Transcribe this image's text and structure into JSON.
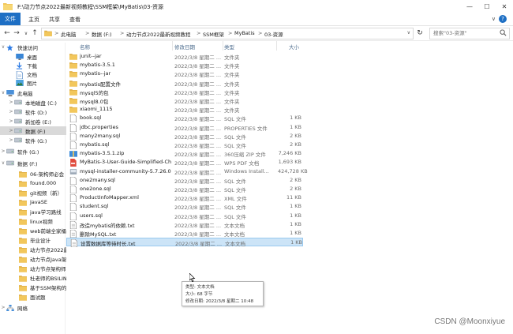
{
  "window": {
    "title": "F:\\动力节点2022最新视频教程\\SSM框架\\MyBatis\\03-资源"
  },
  "window_controls": {
    "minimize": "—",
    "maximize": "☐",
    "close": "✕"
  },
  "menu": {
    "file": "文件",
    "tabs": [
      "主页",
      "共享",
      "查看"
    ],
    "help": "?",
    "collapse": "∨"
  },
  "nav": {
    "back": "←",
    "forward": "→",
    "up_menu": "∨",
    "up": "↑",
    "refresh": "↻",
    "address_dropdown": "∨"
  },
  "address": {
    "crumbs": [
      "此电脑",
      "数据 (F:)",
      "动力节点2022最新视频教程",
      "SSM框架",
      "MyBatis",
      "03-资源"
    ],
    "separator": ">"
  },
  "search": {
    "placeholder": "搜索\"03-资源\""
  },
  "columns": {
    "name": "名称",
    "date": "修改日期",
    "type": "类型",
    "size": "大小"
  },
  "sidebar": [
    {
      "label": "快速访问",
      "icon": "star-icon",
      "chevron": "∨",
      "top": 0
    },
    {
      "label": "桌面",
      "icon": "desktop-icon",
      "pin": "📌"
    },
    {
      "label": "下载",
      "icon": "download-icon",
      "pin": "📌"
    },
    {
      "label": "文档",
      "icon": "document-icon",
      "pin": "📌"
    },
    {
      "label": "图片",
      "icon": "picture-icon",
      "pin": "📌"
    },
    {
      "label": "此电脑",
      "icon": "pc-icon",
      "chevron": "∨"
    },
    {
      "label": "本地磁盘 (C:)",
      "icon": "drive-icon",
      "chevron": ">"
    },
    {
      "label": "软件 (D:)",
      "icon": "drive-icon",
      "chevron": ">"
    },
    {
      "label": "新加卷 (E:)",
      "icon": "drive-icon",
      "chevron": ">"
    },
    {
      "label": "数据 (F:)",
      "icon": "drive-icon",
      "chevron": ">",
      "selected": true
    },
    {
      "label": "软件 (G:)",
      "icon": "drive-icon",
      "chevron": ">"
    },
    {
      "label": "软件 (G:)",
      "icon": "drive-icon",
      "chevron": ">"
    },
    {
      "label": "数据 (F:)",
      "icon": "drive-icon",
      "chevron": "∨"
    },
    {
      "label": "06-架构师必会",
      "icon": "folder-icon"
    },
    {
      "label": "found.000",
      "icon": "folder-icon"
    },
    {
      "label": "git视频（新）",
      "icon": "folder-icon"
    },
    {
      "label": "JavaSE",
      "icon": "folder-icon"
    },
    {
      "label": "java学习路线",
      "icon": "folder-icon"
    },
    {
      "label": "linux视频",
      "icon": "folder-icon"
    },
    {
      "label": "web前端全家桶(服",
      "icon": "folder-icon"
    },
    {
      "label": "毕业设计",
      "icon": "folder-icon"
    },
    {
      "label": "动力节点2022最新",
      "icon": "folder-icon"
    },
    {
      "label": "动力节点Java架构",
      "icon": "folder-icon"
    },
    {
      "label": "动力节点架构师学",
      "icon": "folder-icon"
    },
    {
      "label": "杜老师的BSILINUX",
      "icon": "folder-icon"
    },
    {
      "label": "基于SSM架构的商",
      "icon": "folder-icon"
    },
    {
      "label": "面试题",
      "icon": "folder-icon"
    },
    {
      "label": "网络",
      "icon": "network-icon",
      "chevron": ">"
    }
  ],
  "files": [
    {
      "name": "junit--jar",
      "date": "2022/3/8 星期二 ...",
      "type": "文件夹",
      "size": "",
      "icon": "folder-icon"
    },
    {
      "name": "mybatis-3.5.1",
      "date": "2022/3/8 星期二 ...",
      "type": "文件夹",
      "size": "",
      "icon": "folder-icon"
    },
    {
      "name": "mybatis--jar",
      "date": "2022/3/8 星期二 ...",
      "type": "文件夹",
      "size": "",
      "icon": "folder-icon"
    },
    {
      "name": "mybatis配置文件",
      "date": "2022/3/8 星期二 ...",
      "type": "文件夹",
      "size": "",
      "icon": "folder-icon"
    },
    {
      "name": "mysql5的包",
      "date": "2022/3/8 星期二 ...",
      "type": "文件夹",
      "size": "",
      "icon": "folder-icon"
    },
    {
      "name": "mysql8.0包",
      "date": "2022/3/8 星期二 ...",
      "type": "文件夹",
      "size": "",
      "icon": "folder-icon"
    },
    {
      "name": "xiaomi_1115",
      "date": "2022/3/8 星期二 ...",
      "type": "文件夹",
      "size": "",
      "icon": "folder-icon"
    },
    {
      "name": "book.sql",
      "date": "2022/3/8 星期二 ...",
      "type": "SQL 文件",
      "size": "1 KB",
      "icon": "file-icon"
    },
    {
      "name": "jdbc.properties",
      "date": "2022/3/8 星期二 ...",
      "type": "PROPERTIES 文件",
      "size": "1 KB",
      "icon": "file-icon"
    },
    {
      "name": "many2many.sql",
      "date": "2022/3/8 星期二 ...",
      "type": "SQL 文件",
      "size": "2 KB",
      "icon": "file-icon"
    },
    {
      "name": "mybatis.sql",
      "date": "2022/3/8 星期二 ...",
      "type": "SQL 文件",
      "size": "2 KB",
      "icon": "file-icon"
    },
    {
      "name": "mybatis-3.5.1.zip",
      "date": "2022/3/8 星期二 ...",
      "type": "360压缩 ZIP 文件",
      "size": "7,246 KB",
      "icon": "zip-icon"
    },
    {
      "name": "MyBatis-3-User-Guide-Simplified-Chi...",
      "date": "2022/3/8 星期二 ...",
      "type": "WPS PDF 文档",
      "size": "1,693 KB",
      "icon": "pdf-icon"
    },
    {
      "name": "mysql-installer-community-5.7.26.0.msi",
      "date": "2022/3/8 星期二 ...",
      "type": "Windows Install...",
      "size": "424,728 KB",
      "icon": "msi-icon"
    },
    {
      "name": "one2many.sql",
      "date": "2022/3/8 星期二 ...",
      "type": "SQL 文件",
      "size": "2 KB",
      "icon": "file-icon"
    },
    {
      "name": "one2one.sql",
      "date": "2022/3/8 星期二 ...",
      "type": "SQL 文件",
      "size": "2 KB",
      "icon": "file-icon"
    },
    {
      "name": "ProductInfoMapper.xml",
      "date": "2022/3/8 星期二 ...",
      "type": "XML 文件",
      "size": "11 KB",
      "icon": "file-icon"
    },
    {
      "name": "student.sql",
      "date": "2022/3/8 星期二 ...",
      "type": "SQL 文件",
      "size": "1 KB",
      "icon": "file-icon"
    },
    {
      "name": "users.sql",
      "date": "2022/3/8 星期二 ...",
      "type": "SQL 文件",
      "size": "1 KB",
      "icon": "file-icon"
    },
    {
      "name": "改造mybatis的依赖.txt",
      "date": "2022/3/8 星期二 ...",
      "type": "文本文档",
      "size": "1 KB",
      "icon": "txt-icon"
    },
    {
      "name": "删除MySQL.txt",
      "date": "2022/3/8 星期二 ...",
      "type": "文本文档",
      "size": "1 KB",
      "icon": "txt-icon"
    },
    {
      "name": "设置数据库等待时长.txt",
      "date": "2022/3/8 星期二 ...",
      "type": "文本文档",
      "size": "1 KB",
      "icon": "txt-icon",
      "selected": true
    }
  ],
  "tooltip": {
    "type_line": "类型: 文本文档",
    "size_line": "大小: 68 字节",
    "date_line": "修改日期: 2022/3/8 星期二 10:48"
  },
  "watermark": "CSDN @Moonxiyue",
  "colors": {
    "accent": "#1e6fc4",
    "folder": "#f2c75c",
    "selection": "#cce4f7"
  }
}
